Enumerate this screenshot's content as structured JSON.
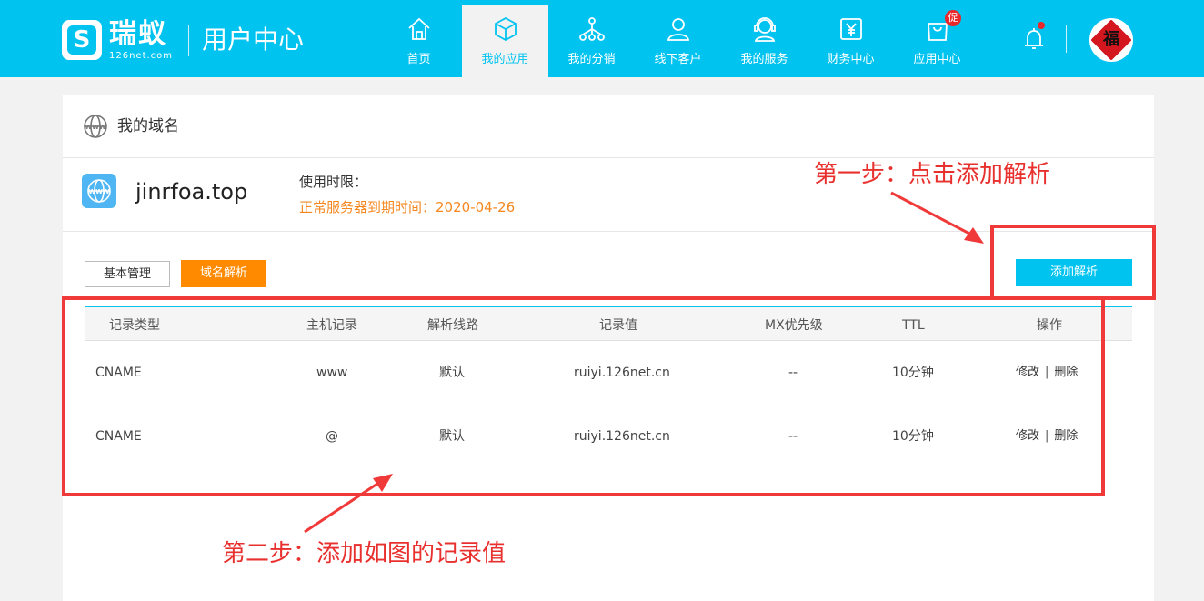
{
  "header": {
    "brand_name": "瑞蚁",
    "brand_sub": "126net.com",
    "site_title": "用户中心",
    "nav": [
      {
        "label": "首页",
        "icon": "home-icon",
        "active": false
      },
      {
        "label": "我的应用",
        "icon": "cube-icon",
        "active": true
      },
      {
        "label": "我的分销",
        "icon": "network-icon",
        "active": false
      },
      {
        "label": "线下客户",
        "icon": "user-icon",
        "active": false
      },
      {
        "label": "我的服务",
        "icon": "headset-icon",
        "active": false
      },
      {
        "label": "财务中心",
        "icon": "yen-icon",
        "active": false
      },
      {
        "label": "应用中心",
        "icon": "bag-icon",
        "active": false,
        "badge": "促"
      }
    ],
    "avatar_text": "福"
  },
  "card": {
    "title": "我的域名",
    "domain": "jinrfoa.top",
    "expire_label": "使用时限：",
    "expire_value": "正常服务器到期时间：2020-04-26",
    "buttons": {
      "basic": "基本管理",
      "dns": "域名解析",
      "add": "添加解析"
    },
    "table": {
      "headers": [
        "记录类型",
        "主机记录",
        "解析线路",
        "记录值",
        "MX优先级",
        "TTL",
        "操作"
      ],
      "rows": [
        {
          "type": "CNAME",
          "host": "www",
          "line": "默认",
          "value": "ruiyi.126net.cn",
          "mx": "--",
          "ttl": "10分钟",
          "edit": "修改",
          "sep": "|",
          "delete": "删除"
        },
        {
          "type": "CNAME",
          "host": "@",
          "line": "默认",
          "value": "ruiyi.126net.cn",
          "mx": "--",
          "ttl": "10分钟",
          "edit": "修改",
          "sep": "|",
          "delete": "删除"
        }
      ]
    }
  },
  "annotations": {
    "step1": "第一步：点击添加解析",
    "step2": "第二步：添加如图的记录值"
  },
  "colors": {
    "header": "#00c3f0",
    "accent_orange": "#ff8a00",
    "expire_orange": "#f5871f",
    "annotation_red": "#f03a3a"
  }
}
